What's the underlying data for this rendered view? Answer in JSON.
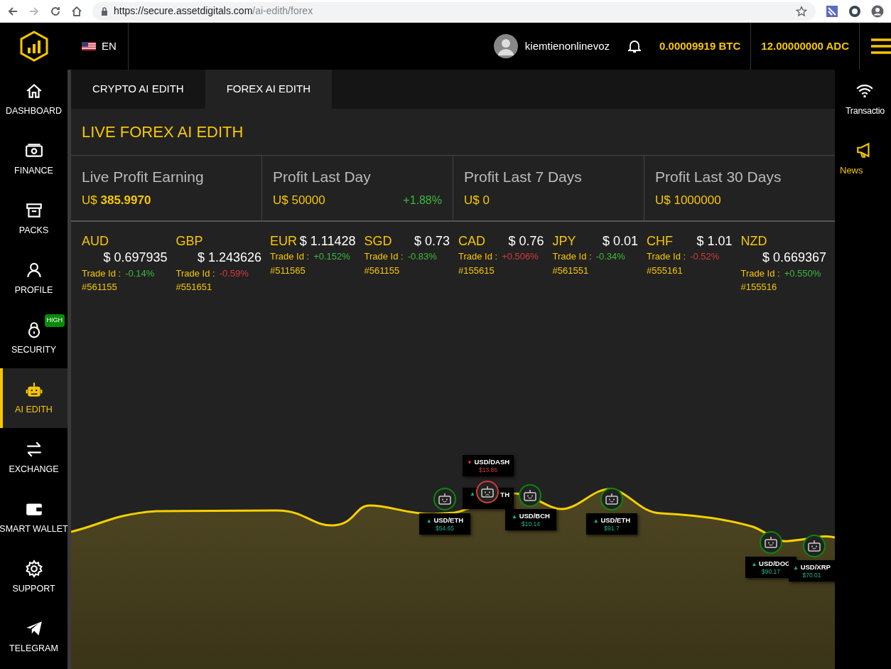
{
  "browser": {
    "url": {
      "host": "https://secure.assetdigitals.com",
      "path": "/ai-edith/forex"
    }
  },
  "header": {
    "language": "EN",
    "username": "kiemtienonlinevoz",
    "btc": "0.00009919 BTC",
    "adc": "12.00000000 ADC"
  },
  "sidebar": [
    {
      "kind": "home",
      "label": "DASHBOARD",
      "selected": false
    },
    {
      "kind": "money",
      "label": "FINANCE",
      "selected": false
    },
    {
      "kind": "box",
      "label": "PACKS",
      "selected": false
    },
    {
      "kind": "person",
      "label": "PROFILE",
      "selected": false
    },
    {
      "kind": "lock",
      "label": "SECURITY",
      "selected": false,
      "badge": "HIGH"
    },
    {
      "kind": "robot",
      "label": "AI EDITH",
      "selected": true
    },
    {
      "kind": "exchange",
      "label": "EXCHANGE",
      "selected": false
    },
    {
      "kind": "wallet",
      "label": "SMART WALLET",
      "selected": false
    },
    {
      "kind": "gear",
      "label": "SUPPORT",
      "selected": false
    },
    {
      "kind": "plane",
      "label": "TELEGRAM",
      "selected": false
    }
  ],
  "tabs": [
    {
      "label": "CRYPTO AI EDITH",
      "selected": false
    },
    {
      "label": "FOREX AI EDITH",
      "selected": true
    }
  ],
  "title": "LIVE FOREX AI EDITH",
  "stats": [
    {
      "label": "Live Profit Earning",
      "value": "U$ **385.9970**"
    },
    {
      "label": "Profit Last Day",
      "value": "U$ 50000",
      "change": "+1.88%"
    },
    {
      "label": "Profit Last 7 Days",
      "value": "U$ 0"
    },
    {
      "label": "Profit Last 30 Days",
      "value": "U$ 1000000"
    }
  ],
  "currencies": [
    {
      "code": "AUD",
      "price": "$ 0.697935",
      "trade_label": "Trade Id :",
      "change": "-0.14%",
      "loss": false,
      "trade_id": "#561155"
    },
    {
      "code": "GBP",
      "price": "$ 1.243626",
      "trade_label": "Trade Id :",
      "change": "-0.59%",
      "loss": true,
      "trade_id": "#551651"
    },
    {
      "code": "EUR",
      "price": "$ 1.11428",
      "trade_label": "Trade Id :",
      "change": "+0.152%",
      "loss": false,
      "trade_id": "#511565"
    },
    {
      "code": "SGD",
      "price": "$ 0.73",
      "trade_label": "Trade Id :",
      "change": "-0.83%",
      "loss": false,
      "trade_id": "#561155"
    },
    {
      "code": "CAD",
      "price": "$ 0.76",
      "trade_label": "Trade Id :",
      "change": "+0.506%",
      "loss": true,
      "trade_id": "#155615"
    },
    {
      "code": "JPY",
      "price": "$ 0.01",
      "trade_label": "Trade Id :",
      "change": "-0.34%",
      "loss": false,
      "trade_id": "#561551"
    },
    {
      "code": "CHF",
      "price": "$ 1.01",
      "trade_label": "Trade Id :",
      "change": "-0.52%",
      "loss": true,
      "trade_id": "#555161"
    },
    {
      "code": "NZD",
      "price": "$ 0.669367",
      "trade_label": "Trade Id :",
      "change": "+0.550%",
      "loss": false,
      "trade_id": "#155516"
    }
  ],
  "markers": [
    {
      "kind": "full",
      "arrow": "▲",
      "pair": "USD/ETH",
      "price": "$54.65",
      "loss": false
    },
    {
      "kind": "label",
      "arrow": "▲",
      "pair": "TH",
      "loss": false
    },
    {
      "kind": "full",
      "arrow": "▼",
      "pair": "USD/DASH",
      "price": "$13.86",
      "loss": true
    },
    {
      "kind": "full",
      "arrow": "▲",
      "pair": "USD/BCH",
      "price": "$10.14",
      "loss": false
    },
    {
      "kind": "full",
      "arrow": "▲",
      "pair": "USD/ETH",
      "price": "$91.7",
      "loss": false
    },
    {
      "kind": "full",
      "arrow": "▲",
      "pair": "USD/DOG",
      "price": "$90.17",
      "loss": false
    },
    {
      "kind": "full",
      "arrow": "▲",
      "pair": "USD/XRP",
      "price": "$70.01",
      "loss": false
    }
  ],
  "right_sidebar": [
    {
      "kind": "wifi",
      "label": "Transactio"
    },
    {
      "kind": "megaphone",
      "label": "News"
    }
  ]
}
